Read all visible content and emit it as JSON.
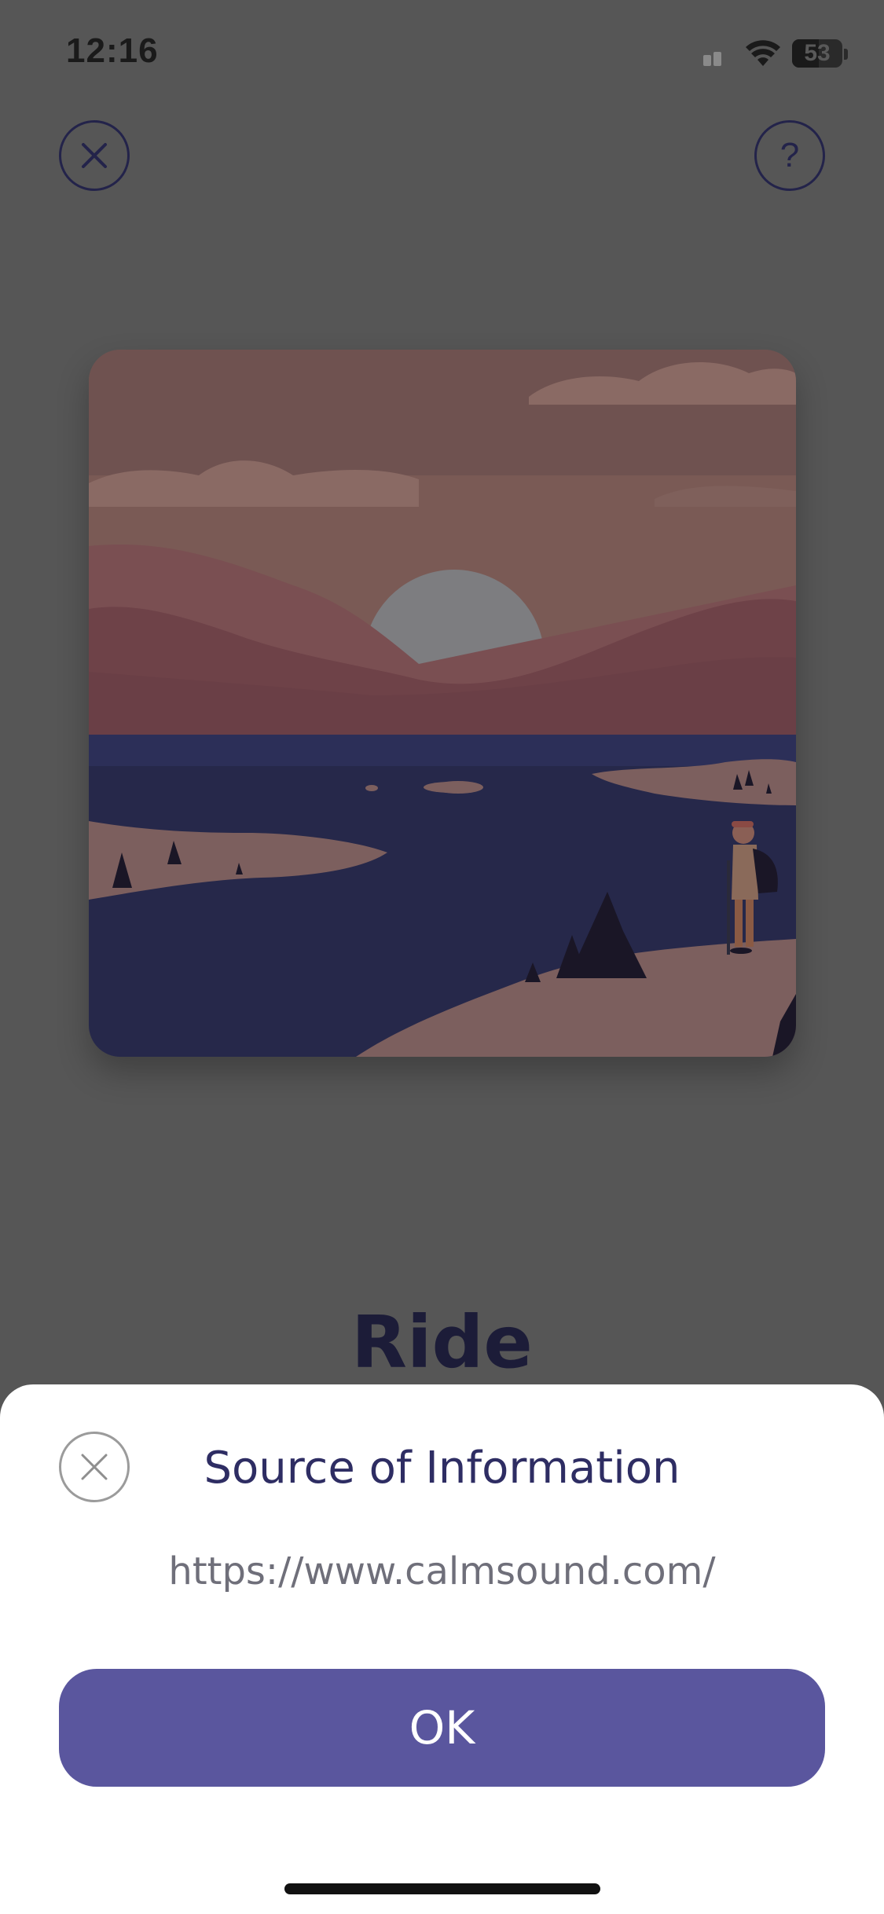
{
  "status_bar": {
    "time": "12:16",
    "battery_level": "53"
  },
  "player": {
    "track_title": "Ride"
  },
  "sheet": {
    "title": "Source of Information",
    "url": "https://www.calmsound.com/",
    "ok_label": "OK"
  },
  "icons": {
    "top_left": "close-icon",
    "top_right": "help-icon",
    "sheet_close": "close-icon"
  },
  "colors": {
    "accent": "#5a569e",
    "title_text": "#2e2d63",
    "overlay_dim": "#565656"
  }
}
